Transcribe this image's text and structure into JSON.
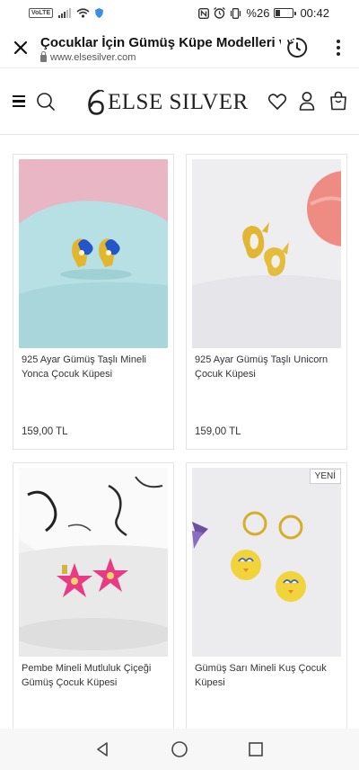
{
  "status_bar": {
    "volte": "VoLTE",
    "battery_percent": "%26",
    "battery_level": 0.26,
    "time": "00:42"
  },
  "browser": {
    "page_title": "Çocuklar İçin Gümüş Küpe Modelleri ve",
    "url": "www.elsesilver.com"
  },
  "site": {
    "logo_text": "ELSE SILVER"
  },
  "products": [
    {
      "name": "925 Ayar Gümüş Taşlı Mineli Yonca Çocuk Küpesi",
      "price": "159,00 TL",
      "badge": ""
    },
    {
      "name": "925 Ayar Gümüş Taşlı Unicorn Çocuk Küpesi",
      "price": "159,00 TL",
      "badge": ""
    },
    {
      "name": "Pembe Mineli Mutluluk Çiçeği Gümüş Çocuk Küpesi",
      "price": "",
      "badge": ""
    },
    {
      "name": "Gümüş Sarı Mineli Kuş Çocuk Küpesi",
      "price": "",
      "badge": "YENİ"
    }
  ],
  "icons": {
    "close": "close-icon",
    "lock": "lock-icon",
    "offline": "clock-icon",
    "more": "more-vert-icon",
    "menu": "hamburger-icon",
    "search": "search-icon",
    "wishlist": "heart-icon",
    "account": "user-icon",
    "cart": "bag-icon",
    "back": "nav-back-icon",
    "home": "nav-home-icon",
    "recents": "nav-recents-icon"
  }
}
